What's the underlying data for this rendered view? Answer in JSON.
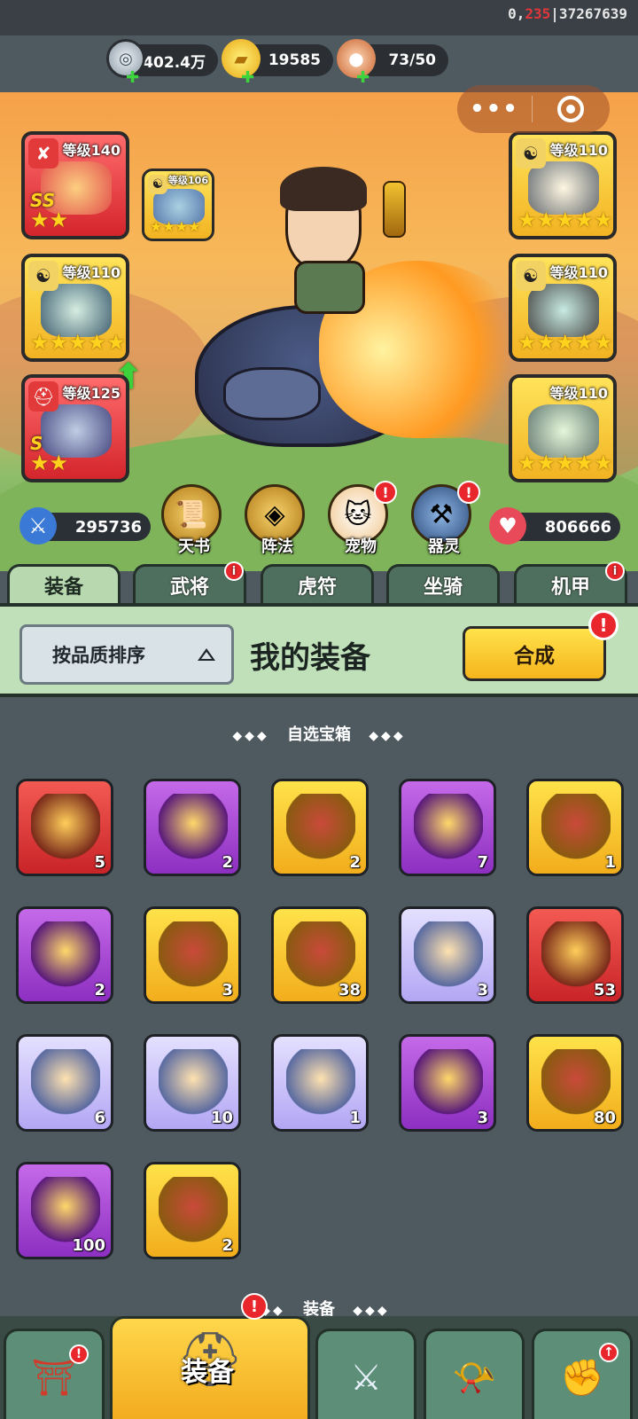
{
  "status": {
    "coords_prefix": "0,",
    "coords_red": "235",
    "coords_suffix": "|37267639"
  },
  "currencies": [
    {
      "icon": "silver-coin-icon",
      "value": "402.4万"
    },
    {
      "icon": "gold-ingot-icon",
      "value": "19585"
    },
    {
      "icon": "meat-stamina-icon",
      "value": "73/50"
    }
  ],
  "capsule": {
    "more": "•••",
    "close": "target-close-icon"
  },
  "slots": {
    "weapon": {
      "level": "等级140",
      "grade": "SS",
      "stars": "★★"
    },
    "mount_gear": {
      "level": "等级106",
      "stars": "★★★★"
    },
    "left2": {
      "level": "等级110",
      "stars": "★★★★★"
    },
    "helmet": {
      "level": "等级125",
      "grade": "S",
      "stars": "★★"
    },
    "right1": {
      "level": "等级110",
      "stars": "★★★★★"
    },
    "right2": {
      "level": "等级110",
      "stars": "★★★★★"
    },
    "right3": {
      "level": "等级110",
      "stars": "★★★★★"
    }
  },
  "stats": {
    "attack": "295736",
    "hp": "806666"
  },
  "features": [
    {
      "label": "天书",
      "icon": "scroll-icon",
      "alert": false
    },
    {
      "label": "阵法",
      "icon": "formation-icon",
      "alert": false
    },
    {
      "label": "宠物",
      "icon": "pet-cat-icon",
      "alert": true
    },
    {
      "label": "器灵",
      "icon": "spirit-icon",
      "alert": true
    }
  ],
  "tabs": [
    {
      "label": "装备",
      "active": true,
      "alert": false
    },
    {
      "label": "武将",
      "active": false,
      "alert": true
    },
    {
      "label": "虎符",
      "active": false,
      "alert": false
    },
    {
      "label": "坐骑",
      "active": false,
      "alert": false
    },
    {
      "label": "机甲",
      "active": false,
      "alert": true
    }
  ],
  "panel": {
    "sort_label": "按品质排序",
    "title": "我的装备",
    "combine_label": "合成",
    "alert": "!"
  },
  "sections": {
    "chest_title": "自选宝箱",
    "equip_title": "装备"
  },
  "items": [
    {
      "color": "red",
      "icon": "red-puzzle-chest-icon",
      "count": "5"
    },
    {
      "color": "purple",
      "icon": "purple-treasure-chest-icon",
      "count": "2"
    },
    {
      "color": "gold",
      "icon": "gold-treasure-chest-icon",
      "count": "2"
    },
    {
      "color": "purple",
      "icon": "purple-sword-shield-icon",
      "count": "7"
    },
    {
      "color": "gold",
      "icon": "gold-sword-shield-icon",
      "count": "1"
    },
    {
      "color": "purple",
      "icon": "purple-puzzle-chest-icon",
      "count": "2"
    },
    {
      "color": "gold",
      "icon": "gold-puzzle-chest-icon",
      "count": "3"
    },
    {
      "color": "gold",
      "icon": "mystery-chest-icon",
      "count": "38"
    },
    {
      "color": "light",
      "icon": "hero-chest-icon",
      "count": "3"
    },
    {
      "color": "red",
      "icon": "red-hero-fragment-icon",
      "count": "53"
    },
    {
      "color": "light",
      "icon": "archer-fragment-icon",
      "count": "6"
    },
    {
      "color": "light",
      "icon": "archer-fragment-icon",
      "count": "10"
    },
    {
      "color": "light",
      "icon": "monkey-fragment-icon",
      "count": "1"
    },
    {
      "color": "purple",
      "icon": "purple-gold-chest-icon",
      "count": "3"
    },
    {
      "color": "gold",
      "icon": "gold-mystery-fragment-icon",
      "count": "80"
    },
    {
      "color": "purple",
      "icon": "purple-mystery-fragment-icon",
      "count": "100"
    },
    {
      "color": "gold",
      "icon": "gold-red-puzzle-chest-icon",
      "count": "2"
    }
  ],
  "nav": {
    "active_label": "装备",
    "buttons": [
      {
        "icon": "gate-coin-icon",
        "alert": "!"
      },
      {
        "icon": "helmet-icon",
        "alert": "!"
      },
      {
        "icon": "crossed-swords-icon",
        "alert": ""
      },
      {
        "icon": "war-horn-icon",
        "alert": ""
      },
      {
        "icon": "power-fist-icon",
        "alert": "↑"
      }
    ]
  }
}
